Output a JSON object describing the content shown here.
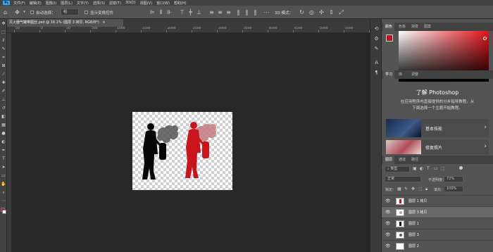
{
  "menubar": {
    "items": [
      "文件(F)",
      "编辑(E)",
      "图像(I)",
      "图层(L)",
      "文字(Y)",
      "选择(S)",
      "滤镜(T)",
      "3D(D)",
      "视图(V)",
      "窗口(W)",
      "帮助(H)"
    ],
    "logo_text": "Ps"
  },
  "options": {
    "auto_select_label": "自动选择：",
    "auto_select_value": "组",
    "show_transform_label": "显示变换控件",
    "three_d_mode_label": "3D 模式："
  },
  "document": {
    "tab_title": "灭火器气罐带图丝.psd @ 16.1% (图层 3 拷贝, RGB/8*)",
    "ruler_labels": [
      "50",
      "0",
      "50",
      "500",
      "1000",
      "1500",
      "2000",
      "2500",
      "3000",
      "3500",
      "4000",
      "4500",
      "5000",
      "5500",
      "6000"
    ]
  },
  "color_panel": {
    "tabs": [
      "颜色",
      "色板",
      "渐变",
      "图案"
    ],
    "foreground_color": "#b01a1e",
    "background_color": "#ffffff",
    "hue_color": "#e3141b"
  },
  "learn_panel": {
    "tabs": [
      "学习",
      "库",
      "调整"
    ],
    "title": "了解 Photoshop",
    "desc_line1": "在应用程序内直接提供的分步指导教程。从",
    "desc_line2": "下面选择一个主题开始教程。",
    "cards": [
      {
        "label": "基本技能"
      },
      {
        "label": "修复照片"
      }
    ]
  },
  "layers_panel": {
    "tabs": [
      "图层",
      "通道",
      "路径"
    ],
    "filter_label": "类型",
    "blend_mode": "正常",
    "opacity_label": "不透明度：",
    "opacity_value": "72%",
    "lock_label": "锁定：",
    "fill_label": "填充：",
    "fill_value": "100%",
    "layers": [
      {
        "name": "图层 1 拷贝",
        "selected": false
      },
      {
        "name": "图层 3 拷贝",
        "selected": true
      },
      {
        "name": "图层 1",
        "selected": false
      },
      {
        "name": "图层 3",
        "selected": false
      },
      {
        "name": "图层 2",
        "selected": false
      }
    ]
  }
}
